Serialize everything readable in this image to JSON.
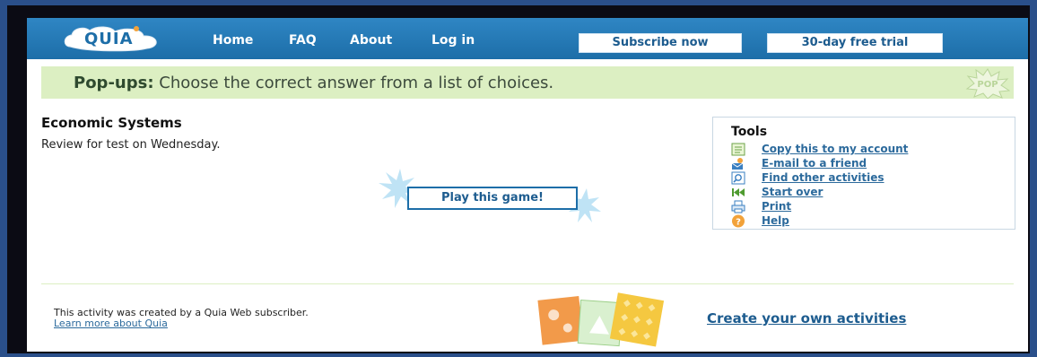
{
  "header": {
    "logo_text": "QUIA",
    "nav": [
      "Home",
      "FAQ",
      "About",
      "Log in"
    ],
    "subscribe_label": "Subscribe now",
    "trial_label": "30-day free trial"
  },
  "banner": {
    "strong": "Pop-ups:",
    "text": " Choose the correct answer from a list of choices.",
    "badge_text": "POP"
  },
  "activity": {
    "title": "Economic Systems",
    "description": "Review for test on Wednesday.",
    "play_label": "Play this game!"
  },
  "tools": {
    "title": "Tools",
    "items": [
      {
        "label": "Copy this to my account",
        "icon": "copy-icon"
      },
      {
        "label": "E-mail to a friend",
        "icon": "email-icon"
      },
      {
        "label": "Find other activities",
        "icon": "find-icon"
      },
      {
        "label": "Start over",
        "icon": "start-over-icon"
      },
      {
        "label": "Print",
        "icon": "print-icon"
      },
      {
        "label": "Help",
        "icon": "help-icon"
      }
    ]
  },
  "footer": {
    "created_text": "This activity was created by a Quia Web subscriber.",
    "learn_more": "Learn more about Quia",
    "create_link": "Create your own activities"
  },
  "colors": {
    "header_blue": "#1d6ea8",
    "banner_green": "#dcefc2",
    "link_blue": "#2c6a9c"
  }
}
